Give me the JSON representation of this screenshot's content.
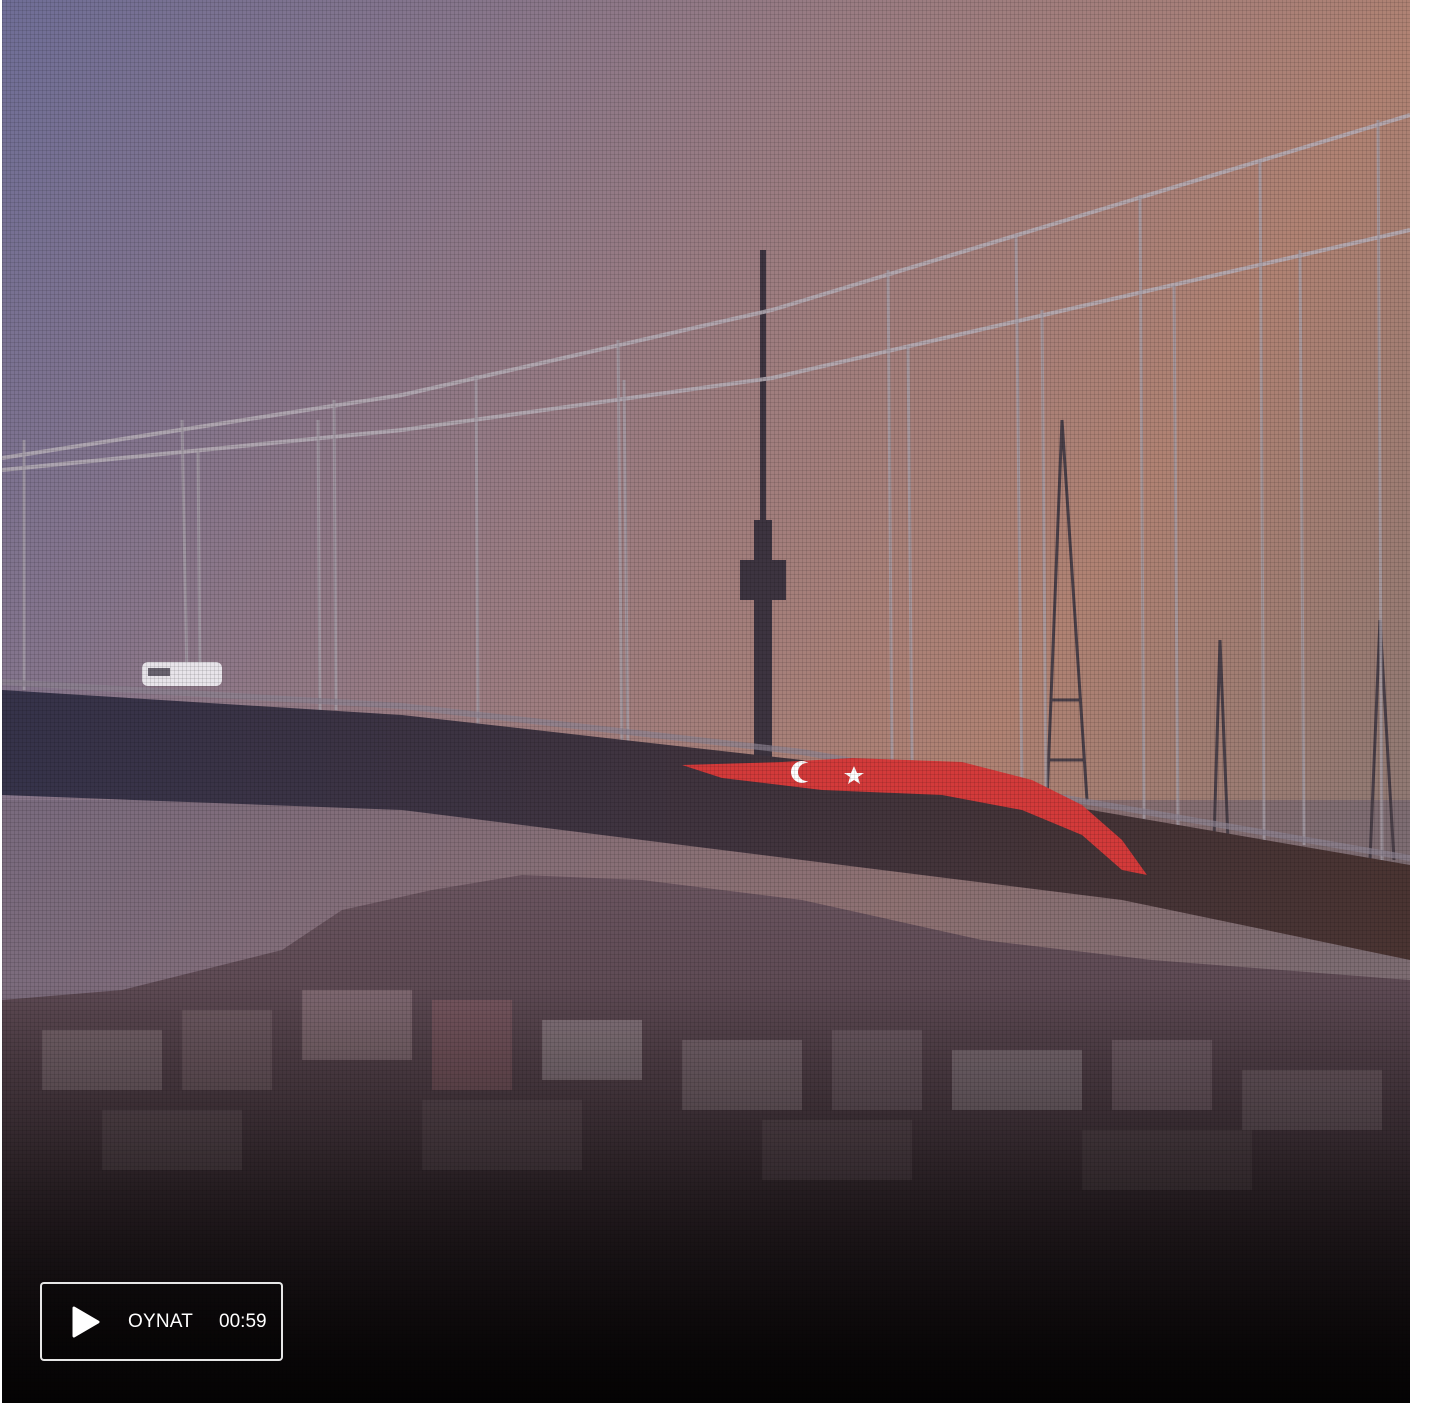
{
  "video": {
    "play_label": "OYNAT",
    "duration": "00:59",
    "icons": {
      "play": "play-icon"
    }
  }
}
